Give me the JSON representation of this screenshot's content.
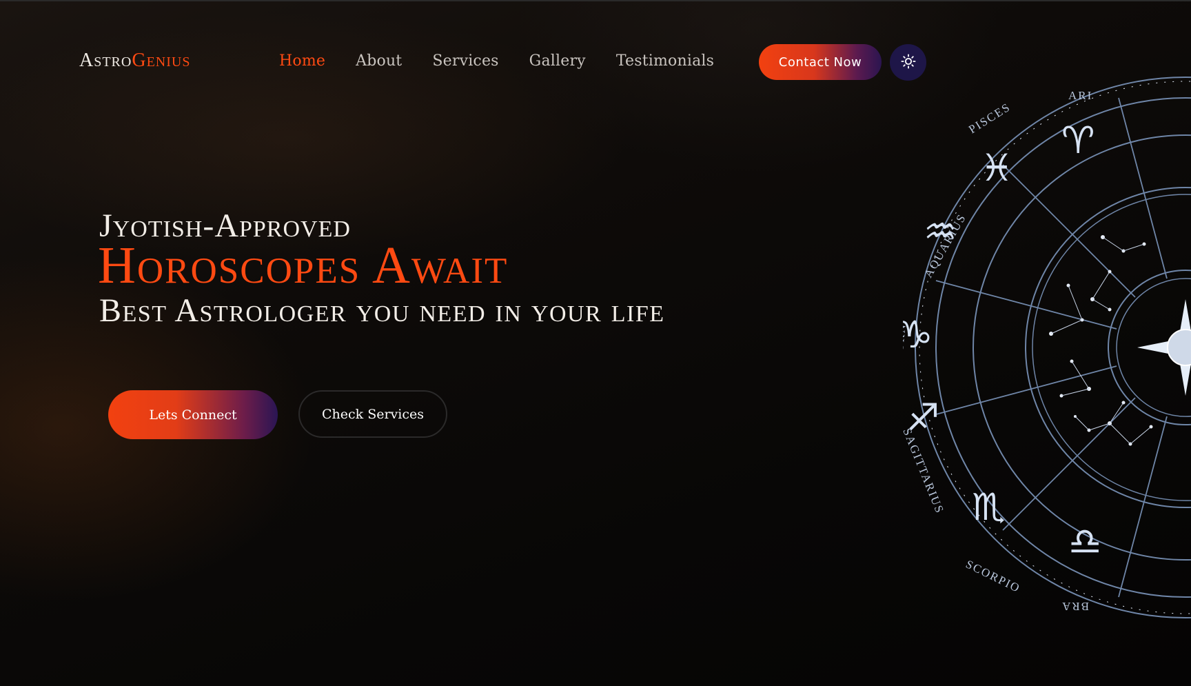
{
  "brand": {
    "name_part1": "Astro",
    "name_part2": "Genius"
  },
  "nav": {
    "items": [
      {
        "label": "Home",
        "active": true
      },
      {
        "label": "About",
        "active": false
      },
      {
        "label": "Services",
        "active": false
      },
      {
        "label": "Gallery",
        "active": false
      },
      {
        "label": "Testimonials",
        "active": false
      }
    ]
  },
  "header": {
    "contact_label": "Contact Now",
    "theme_toggle_icon": "sun-icon"
  },
  "hero": {
    "line1": "Jyotish-Approved",
    "line2": "Horoscopes Await",
    "line3": "Best Astrologer you need in your life",
    "primary_cta": "Lets Connect",
    "secondary_cta": "Check Services"
  },
  "zodiac_wheel": {
    "signs": [
      "ARIES",
      "PISCES",
      "AQUARIUS",
      "CAPRICORN",
      "SAGITTARIUS",
      "SCORPIO",
      "LIBRA"
    ],
    "visible_labels": [
      "ARI",
      "PISCES",
      "AQUARIUS",
      "CAPRICORN",
      "SAGITTARIUS",
      "SCORPIO",
      "BRA"
    ]
  },
  "colors": {
    "accent": "#ff4a12",
    "gradient_end": "#2a1554",
    "toggle_bg": "#1e1648",
    "wheel_line": "#6f86a8"
  }
}
